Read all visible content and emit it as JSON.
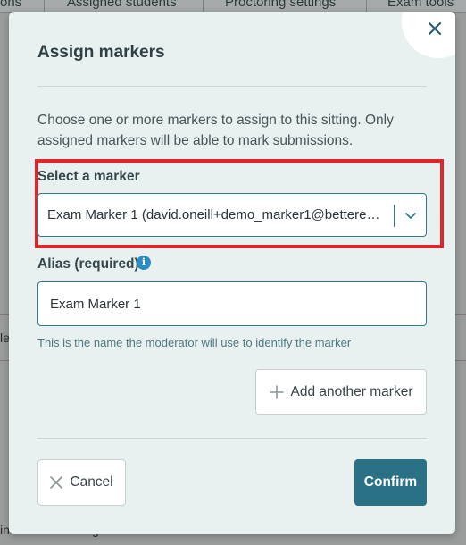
{
  "background": {
    "tabs": [
      "ons",
      "Assigned students",
      "Proctoring settings",
      "Exam tools"
    ],
    "fragments": [
      "le",
      "in",
      "g"
    ]
  },
  "modal": {
    "title": "Assign markers",
    "description": "Choose one or more markers to assign to this sitting. Only assigned markers will be able to mark submissions.",
    "select_label": "Select a marker",
    "selected_marker": "Exam Marker 1 (david.oneill+demo_marker1@bettere…",
    "alias_label": "Alias (required)",
    "alias_value": "Exam Marker 1",
    "alias_hint": "This is the name the moderator will use to identify the marker",
    "add_marker_label": "Add another marker",
    "cancel_label": "Cancel",
    "confirm_label": "Confirm"
  },
  "icons": {
    "close": "close-icon",
    "chevron": "chevron-down-icon",
    "info": "info-icon",
    "plus": "plus-icon",
    "cancel": "x-icon"
  },
  "colors": {
    "accent": "#2a7186",
    "highlight": "#e0262b",
    "info": "#2b8cc4"
  }
}
